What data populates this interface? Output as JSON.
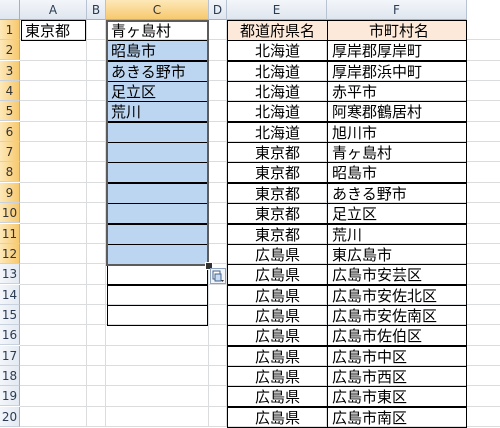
{
  "columns": [
    "A",
    "B",
    "C",
    "D",
    "E",
    "F"
  ],
  "selected_column": "C",
  "rows": [
    "1",
    "2",
    "3",
    "4",
    "5",
    "6",
    "7",
    "8",
    "9",
    "10",
    "11",
    "12",
    "13",
    "14",
    "15",
    "16",
    "17",
    "18",
    "19",
    "20"
  ],
  "cells": {
    "A1": "東京都",
    "C1": "青ヶ島村",
    "C2": "昭島市",
    "C3": "あきる野市",
    "C4": "足立区",
    "C5": "荒川"
  },
  "table": {
    "headers": [
      "都道府県名",
      "市町村名"
    ],
    "rows": [
      [
        "北海道",
        "厚岸郡厚岸町"
      ],
      [
        "北海道",
        "厚岸郡浜中町"
      ],
      [
        "北海道",
        "赤平市"
      ],
      [
        "北海道",
        "阿寒郡鶴居村"
      ],
      [
        "北海道",
        "旭川市"
      ],
      [
        "東京都",
        "青ヶ島村"
      ],
      [
        "東京都",
        "昭島市"
      ],
      [
        "東京都",
        "あきる野市"
      ],
      [
        "東京都",
        "足立区"
      ],
      [
        "東京都",
        "荒川"
      ],
      [
        "広島県",
        "東広島市"
      ],
      [
        "広島県",
        "広島市安芸区"
      ],
      [
        "広島県",
        "広島市安佐北区"
      ],
      [
        "広島県",
        "広島市安佐南区"
      ],
      [
        "広島県",
        "広島市佐伯区"
      ],
      [
        "広島県",
        "広島市中区"
      ],
      [
        "広島県",
        "広島市西区"
      ],
      [
        "広島県",
        "広島市東区"
      ],
      [
        "広島県",
        "広島市南区"
      ]
    ]
  },
  "colors": {
    "selection_fill": "#bcd6f2",
    "header_fill": "#fde9d9",
    "gridline": "#dadcdd",
    "column_header": "#dfe6ef"
  },
  "paste_options_icon": "paste-options-icon"
}
